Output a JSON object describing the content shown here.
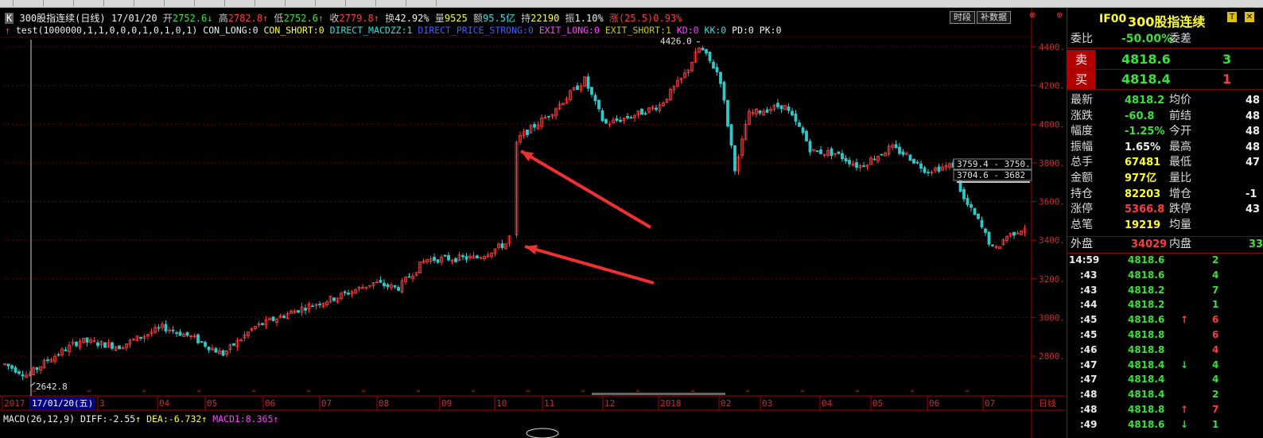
{
  "toolbar": {
    "icons": [
      "kline-icon",
      "play-icon",
      "pan-icon",
      "zoom-in-icon",
      "zoom-out-icon",
      "gear-icon",
      "cursor-icon",
      "draw-line-icon",
      "ray-icon",
      "rect-icon",
      "text-icon",
      "copy-icon",
      "delete-icon",
      "indicator-icon",
      "template-icon"
    ]
  },
  "header": {
    "badge": "K",
    "title": "300股指连续(日线)",
    "date": "17/01/20",
    "open_label": "开",
    "open": "2752.6",
    "high_label": "高",
    "high": "2782.8",
    "low_label": "低",
    "low": "2752.6",
    "close_label": "收",
    "close": "2779.8",
    "turnover_label": "换",
    "turnover": "42.92%",
    "volume_label": "量",
    "volume": "9525",
    "amount_label": "额",
    "amount": "95.5亿",
    "oi_label": "持",
    "oi": "22190",
    "amp_label": "振",
    "amp": "1.10%",
    "chg_label": "涨",
    "chg": "(25.5)0.93%",
    "btn_period": "时段",
    "btn_supplement": "补数据"
  },
  "indicator_line": {
    "name": "test(1000000,1,1,0,0,0,1,0,1,0,1)",
    "con_long": "CON_LONG:0",
    "con_short": "CON_SHORT:0",
    "direct_macdzz": "DIRECT_MACDZZ:1",
    "direct_price_strong": "DIRECT_PRICE_STRONG:0",
    "exit_long": "EXIT_LONG:0",
    "exit_short": "EXIT_SHORT:1",
    "kd": "KD:0",
    "kk": "KK:0",
    "pd": "PD:0",
    "pk": "PK:0"
  },
  "annotations": {
    "high_label": "4426.0",
    "low_label": "2642.8",
    "box1": "3759.4 - 3750.",
    "box2": "3704.6 - 3682"
  },
  "chart_data": {
    "type": "candlestick",
    "y_ticks": [
      "4400.0",
      "4200.0",
      "4000.0",
      "3800.0",
      "3600.0",
      "3400.0",
      "3200.0",
      "3000.0",
      "2800.0"
    ],
    "ylim": [
      2600,
      4500
    ],
    "x_labels": [
      "2017",
      "17/01/20(五)",
      "3",
      "04",
      "05",
      "06",
      "07",
      "08",
      "09",
      "10",
      "11",
      "12",
      "2018",
      "02",
      "03",
      "04",
      "05",
      "06",
      "07"
    ],
    "period_label": "日线",
    "high": 4426.0,
    "low": 2642.8,
    "up_color": "#ff3c3c",
    "down_color": "#30c8c8"
  },
  "macd": {
    "name": "MACD(26,12,9)",
    "diff": "DIFF:-2.55",
    "dea": "DEA:-6.732",
    "macd": "MACD1:8.365"
  },
  "right_panel": {
    "code": "IF00",
    "name": "300股指连续",
    "t_badge": "T",
    "weibi_label": "委比",
    "weibi": "-50.00%",
    "weicha_label": "委差",
    "sell_label": "卖",
    "sell_price": "4818.6",
    "sell_vol": "3",
    "buy_label": "买",
    "buy_price": "4818.4",
    "buy_vol": "1",
    "stats": [
      {
        "l1": "最新",
        "v1": "4818.2",
        "c1": "green",
        "l2": "均价",
        "v2": "48"
      },
      {
        "l1": "涨跌",
        "v1": "-60.8",
        "c1": "green",
        "l2": "前结",
        "v2": "48"
      },
      {
        "l1": "幅度",
        "v1": "-1.25%",
        "c1": "green",
        "l2": "今开",
        "v2": "48"
      },
      {
        "l1": "振幅",
        "v1": "1.65%",
        "c1": "white",
        "l2": "最高",
        "v2": "48"
      },
      {
        "l1": "总手",
        "v1": "67481",
        "c1": "yellow",
        "l2": "最低",
        "v2": "47"
      },
      {
        "l1": "金额",
        "v1": "977亿",
        "c1": "yellow",
        "l2": "量比",
        "v2": ""
      },
      {
        "l1": "持仓",
        "v1": "82203",
        "c1": "yellow",
        "l2": "增仓",
        "v2": "-1"
      },
      {
        "l1": "涨停",
        "v1": "5366.8",
        "c1": "red",
        "l2": "跌停",
        "v2": "43"
      },
      {
        "l1": "总笔",
        "v1": "19219",
        "c1": "yellow",
        "l2": "均量",
        "v2": ""
      }
    ],
    "outer_label": "外盘",
    "outer": "34029",
    "inner_label": "内盘",
    "inner": "33",
    "trades": [
      {
        "t": "14:59",
        "p": "4818.6",
        "arrow": "",
        "v": "2",
        "vc": "green"
      },
      {
        "t": ":43",
        "p": "4818.6",
        "arrow": "",
        "v": "4",
        "vc": "green"
      },
      {
        "t": ":43",
        "p": "4818.2",
        "arrow": "",
        "v": "7",
        "vc": "green"
      },
      {
        "t": ":44",
        "p": "4818.2",
        "arrow": "",
        "v": "1",
        "vc": "green"
      },
      {
        "t": ":45",
        "p": "4818.6",
        "arrow": "↑",
        "v": "6",
        "vc": "red"
      },
      {
        "t": ":45",
        "p": "4818.8",
        "arrow": "",
        "v": "6",
        "vc": "red"
      },
      {
        "t": ":46",
        "p": "4818.8",
        "arrow": "",
        "v": "4",
        "vc": "red"
      },
      {
        "t": ":47",
        "p": "4818.4",
        "arrow": "↓",
        "v": "4",
        "vc": "green"
      },
      {
        "t": ":47",
        "p": "4818.4",
        "arrow": "",
        "v": "4",
        "vc": "green"
      },
      {
        "t": ":48",
        "p": "4818.4",
        "arrow": "",
        "v": "2",
        "vc": "green"
      },
      {
        "t": ":48",
        "p": "4818.8",
        "arrow": "↑",
        "v": "7",
        "vc": "red"
      },
      {
        "t": ":49",
        "p": "4818.6",
        "arrow": "↓",
        "v": "1",
        "vc": "green"
      }
    ]
  }
}
